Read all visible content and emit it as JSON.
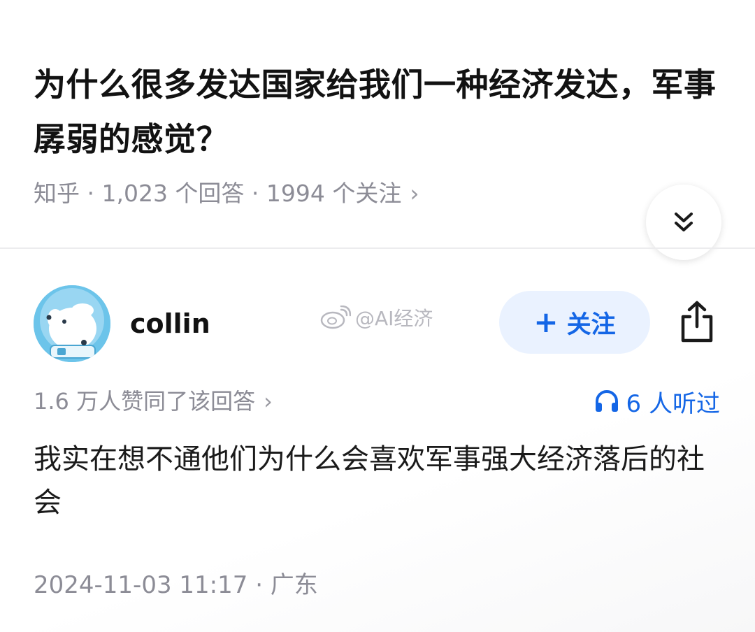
{
  "question": {
    "title": "为什么很多发达国家给我们一种经济发达，军事孱弱的感觉？",
    "meta": "知乎 · 1,023 个回答 · 1994 个关注",
    "meta_chevron": "›"
  },
  "collapse_button": {
    "icon": "double-chevron-down-icon"
  },
  "author": {
    "name": "collin",
    "avatar_icon": "dog-astronaut-avatar",
    "follow_plus": "+",
    "follow_label": "关注",
    "share_icon": "share-icon"
  },
  "watermark": {
    "icon": "weibo-icon",
    "text": "@AI经济"
  },
  "answer": {
    "likes_text": "1.6 万人赞同了该回答",
    "likes_chevron": "›",
    "listen_icon": "headphones-icon",
    "listen_text": "6 人听过",
    "body": "我实在想不通他们为什么会喜欢军事强大经济落后的社会",
    "footer": "2024-11-03 11:17 · 广东"
  },
  "colors": {
    "accent": "#1466e6",
    "follow_bg": "#eaf2ff",
    "muted_text": "#8c8c96",
    "avatar_bg": "#6cc4ea"
  }
}
